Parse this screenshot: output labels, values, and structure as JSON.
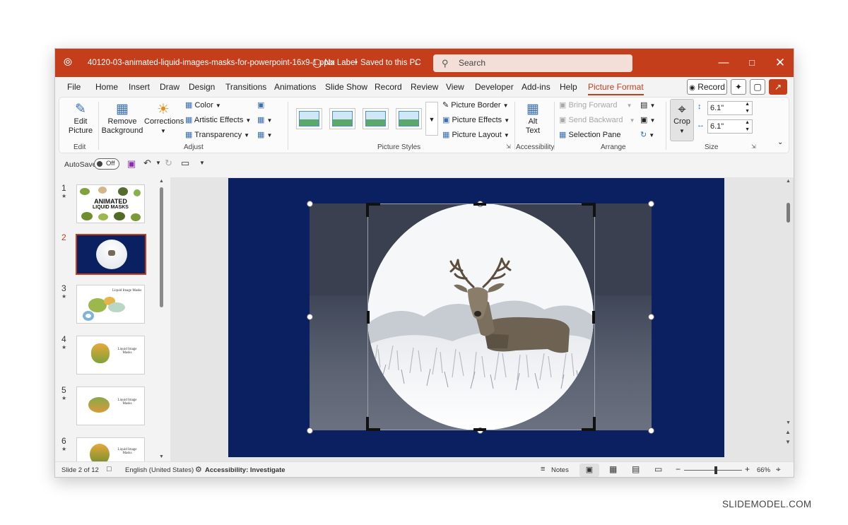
{
  "window": {
    "file_name": "40120-03-animated-liquid-images-masks-for-powerpoint-16x9-1.pptx",
    "label": "No Label",
    "save_status": "Saved to this PC",
    "search_placeholder": "Search",
    "minimize_icon": "minimize-icon",
    "maximize_icon": "maximize-icon",
    "close_icon": "close-icon"
  },
  "menu": {
    "tabs": [
      "File",
      "Home",
      "Insert",
      "Draw",
      "Design",
      "Transitions",
      "Animations",
      "Slide Show",
      "Record",
      "Review",
      "View",
      "Developer",
      "Add-ins",
      "Help",
      "Picture Format"
    ],
    "active_tab": "Picture Format",
    "record_label": "Record"
  },
  "ribbon": {
    "edit_picture": "Edit Picture",
    "edit_group": "Edit",
    "remove_background": "Remove Background",
    "corrections": "Corrections",
    "color": "Color",
    "artistic_effects": "Artistic Effects",
    "transparency": "Transparency",
    "adjust_group": "Adjust",
    "picture_styles_group": "Picture Styles",
    "picture_border": "Picture Border",
    "picture_effects": "Picture Effects",
    "picture_layout": "Picture Layout",
    "alt_text": "Alt Text",
    "accessibility_group": "Accessibility",
    "bring_forward": "Bring Forward",
    "send_backward": "Send Backward",
    "selection_pane": "Selection Pane",
    "arrange_group": "Arrange",
    "crop": "Crop",
    "height": "6.1\"",
    "width": "6.1\"",
    "size_group": "Size"
  },
  "qat": {
    "autosave_label": "AutoSave",
    "autosave_state": "Off"
  },
  "slides": [
    {
      "num": "1",
      "title": "ANIMATED",
      "subtitle": "LIQUID MASKS"
    },
    {
      "num": "2"
    },
    {
      "num": "3",
      "title": "Liquid Image Masks"
    },
    {
      "num": "4",
      "title": "Liquid Image Masks"
    },
    {
      "num": "5",
      "title": "Liquid Image Masks"
    },
    {
      "num": "6",
      "title": "Liquid Image Masks"
    }
  ],
  "active_slide": "2",
  "status": {
    "slide_info": "Slide 2 of 12",
    "language": "English (United States)",
    "accessibility": "Accessibility: Investigate",
    "notes": "Notes",
    "zoom": "66%",
    "zoom_level": 0.55
  },
  "watermark": "SLIDEMODEL.COM",
  "colors": {
    "accent": "#c43e1c",
    "slide_background": "#0b2060"
  }
}
